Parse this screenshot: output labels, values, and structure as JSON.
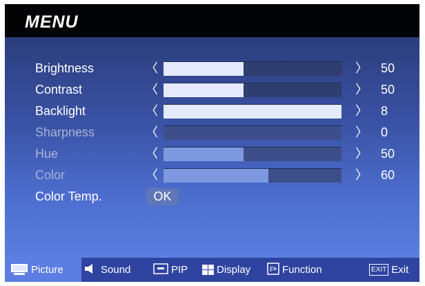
{
  "menu": {
    "title": "MENU"
  },
  "settings": [
    {
      "label": "Brightness",
      "value": "50",
      "level": 0.45,
      "enabled": true
    },
    {
      "label": "Contrast",
      "value": "50",
      "level": 0.45,
      "enabled": true
    },
    {
      "label": "Backlight",
      "value": "8",
      "level": 1.0,
      "enabled": true
    },
    {
      "label": "Sharpness",
      "value": "0",
      "level": 0.0,
      "enabled": false
    },
    {
      "label": "Hue",
      "value": "50",
      "level": 0.45,
      "enabled": false
    },
    {
      "label": "Color",
      "value": "60",
      "level": 0.59,
      "enabled": false
    }
  ],
  "color_temp": {
    "label": "Color Temp.",
    "button": "OK"
  },
  "arrows": {
    "left": "〈",
    "right": "〉"
  },
  "nav": [
    {
      "label": "Picture",
      "icon": "monitor-icon",
      "active": true
    },
    {
      "label": "Sound",
      "icon": "speaker-icon",
      "active": false
    },
    {
      "label": "PIP",
      "icon": "pip-icon",
      "active": false
    },
    {
      "label": "Display",
      "icon": "display-grid-icon",
      "active": false
    },
    {
      "label": "Function",
      "icon": "function-icon",
      "active": false
    },
    {
      "label": "Exit",
      "icon": "exit-icon",
      "active": false,
      "icon_text": "EXIT"
    }
  ],
  "colors": {
    "title_bg": "#020305",
    "panel_top": "#2b3d7c",
    "panel_bottom": "#5a7fe0",
    "bar_fill": "#e4e9fb",
    "nav_bg": "#2e44a0",
    "nav_active": "#5c7ee3"
  }
}
